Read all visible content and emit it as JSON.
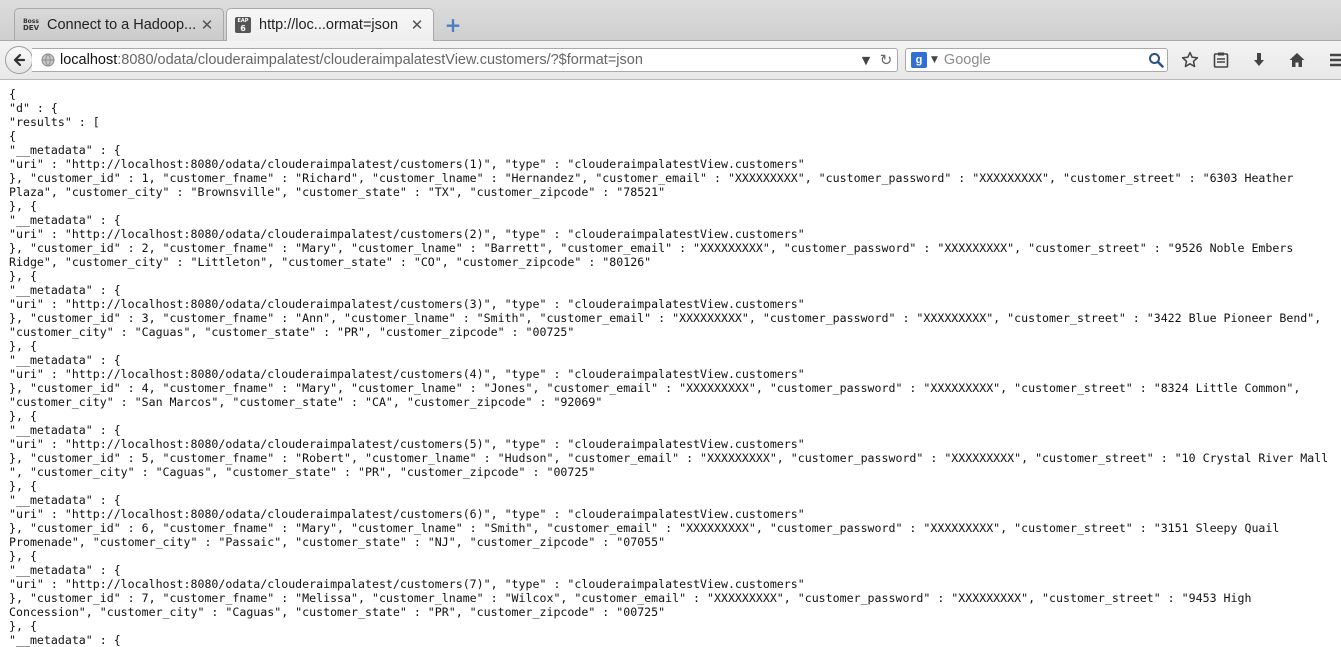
{
  "tabs": [
    {
      "title": "Connect to a Hadoop...",
      "favicon_top": "Boss",
      "favicon_bottom": "DEV",
      "active": false
    },
    {
      "title": "http://loc...ormat=json",
      "favicon_top": "EAP",
      "favicon_bottom": "6",
      "active": true
    }
  ],
  "url": {
    "host": "localhost",
    "rest": ":8080/odata/clouderaimpalatest/clouderaimpalatestView.customers/?$format=json"
  },
  "search": {
    "placeholder": "Google",
    "engine_letter": "g"
  },
  "icons": {
    "back": "back-arrow-icon",
    "globe": "globe-icon",
    "reload": "reload-icon",
    "bookmark": "star-icon",
    "reading_list": "clipboard-icon",
    "downloads": "download-icon",
    "home": "home-icon",
    "menu": "menu-icon",
    "new_tab": "plus-icon",
    "close_tab": "close-icon"
  },
  "colors": {
    "accent": "#4a7fc1",
    "search_engine": "#2f6fd6"
  },
  "json_lines": [
    "{",
    "\"d\" : {",
    "\"results\" : [",
    "{",
    "\"__metadata\" : {",
    "\"uri\" : \"http://localhost:8080/odata/clouderaimpalatest/customers(1)\", \"type\" : \"clouderaimpalatestView.customers\"",
    "}, \"customer_id\" : 1, \"customer_fname\" : \"Richard\", \"customer_lname\" : \"Hernandez\", \"customer_email\" : \"XXXXXXXXX\", \"customer_password\" : \"XXXXXXXXX\", \"customer_street\" : \"6303 Heather",
    "Plaza\", \"customer_city\" : \"Brownsville\", \"customer_state\" : \"TX\", \"customer_zipcode\" : \"78521\"",
    "}, {",
    "\"__metadata\" : {",
    "\"uri\" : \"http://localhost:8080/odata/clouderaimpalatest/customers(2)\", \"type\" : \"clouderaimpalatestView.customers\"",
    "}, \"customer_id\" : 2, \"customer_fname\" : \"Mary\", \"customer_lname\" : \"Barrett\", \"customer_email\" : \"XXXXXXXXX\", \"customer_password\" : \"XXXXXXXXX\", \"customer_street\" : \"9526 Noble Embers",
    "Ridge\", \"customer_city\" : \"Littleton\", \"customer_state\" : \"CO\", \"customer_zipcode\" : \"80126\"",
    "}, {",
    "\"__metadata\" : {",
    "\"uri\" : \"http://localhost:8080/odata/clouderaimpalatest/customers(3)\", \"type\" : \"clouderaimpalatestView.customers\"",
    "}, \"customer_id\" : 3, \"customer_fname\" : \"Ann\", \"customer_lname\" : \"Smith\", \"customer_email\" : \"XXXXXXXXX\", \"customer_password\" : \"XXXXXXXXX\", \"customer_street\" : \"3422 Blue Pioneer Bend\",",
    "\"customer_city\" : \"Caguas\", \"customer_state\" : \"PR\", \"customer_zipcode\" : \"00725\"",
    "}, {",
    "\"__metadata\" : {",
    "\"uri\" : \"http://localhost:8080/odata/clouderaimpalatest/customers(4)\", \"type\" : \"clouderaimpalatestView.customers\"",
    "}, \"customer_id\" : 4, \"customer_fname\" : \"Mary\", \"customer_lname\" : \"Jones\", \"customer_email\" : \"XXXXXXXXX\", \"customer_password\" : \"XXXXXXXXX\", \"customer_street\" : \"8324 Little Common\",",
    "\"customer_city\" : \"San Marcos\", \"customer_state\" : \"CA\", \"customer_zipcode\" : \"92069\"",
    "}, {",
    "\"__metadata\" : {",
    "\"uri\" : \"http://localhost:8080/odata/clouderaimpalatest/customers(5)\", \"type\" : \"clouderaimpalatestView.customers\"",
    "}, \"customer_id\" : 5, \"customer_fname\" : \"Robert\", \"customer_lname\" : \"Hudson\", \"customer_email\" : \"XXXXXXXXX\", \"customer_password\" : \"XXXXXXXXX\", \"customer_street\" : \"10 Crystal River Mall",
    "\", \"customer_city\" : \"Caguas\", \"customer_state\" : \"PR\", \"customer_zipcode\" : \"00725\"",
    "}, {",
    "\"__metadata\" : {",
    "\"uri\" : \"http://localhost:8080/odata/clouderaimpalatest/customers(6)\", \"type\" : \"clouderaimpalatestView.customers\"",
    "}, \"customer_id\" : 6, \"customer_fname\" : \"Mary\", \"customer_lname\" : \"Smith\", \"customer_email\" : \"XXXXXXXXX\", \"customer_password\" : \"XXXXXXXXX\", \"customer_street\" : \"3151 Sleepy Quail",
    "Promenade\", \"customer_city\" : \"Passaic\", \"customer_state\" : \"NJ\", \"customer_zipcode\" : \"07055\"",
    "}, {",
    "\"__metadata\" : {",
    "\"uri\" : \"http://localhost:8080/odata/clouderaimpalatest/customers(7)\", \"type\" : \"clouderaimpalatestView.customers\"",
    "}, \"customer_id\" : 7, \"customer_fname\" : \"Melissa\", \"customer_lname\" : \"Wilcox\", \"customer_email\" : \"XXXXXXXXX\", \"customer_password\" : \"XXXXXXXXX\", \"customer_street\" : \"9453 High",
    "Concession\", \"customer_city\" : \"Caguas\", \"customer_state\" : \"PR\", \"customer_zipcode\" : \"00725\"",
    "}, {",
    "\"__metadata\" : {"
  ]
}
